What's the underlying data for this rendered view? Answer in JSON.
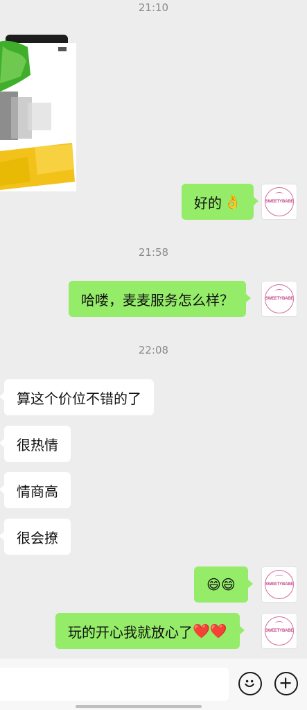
{
  "timestamps": [
    "21:10",
    "21:58",
    "22:08"
  ],
  "messages": {
    "m1": {
      "text": "好的",
      "emoji": "👌"
    },
    "m2": {
      "text": "哈喽，麦麦服务怎么样？"
    },
    "m3": {
      "text": "算这个价位不错的了"
    },
    "m4": {
      "text": "很热情"
    },
    "m5": {
      "text": "情商高"
    },
    "m6": {
      "text": "很会撩"
    },
    "m7": {
      "emoji": "😄😄"
    },
    "m8": {
      "text": "玩的开心我就放心了",
      "emoji": "❤️❤️"
    }
  },
  "avatar": {
    "brand": "SWEETYBABE",
    "color": "#c8458a"
  },
  "colors": {
    "outgoing_bubble": "#95ec69",
    "incoming_bubble": "#ffffff",
    "background": "#ededed"
  },
  "input": {
    "placeholder": "",
    "value": ""
  },
  "icons": {
    "emoji_button": "smiley-icon",
    "more_button": "plus-circle-icon"
  }
}
